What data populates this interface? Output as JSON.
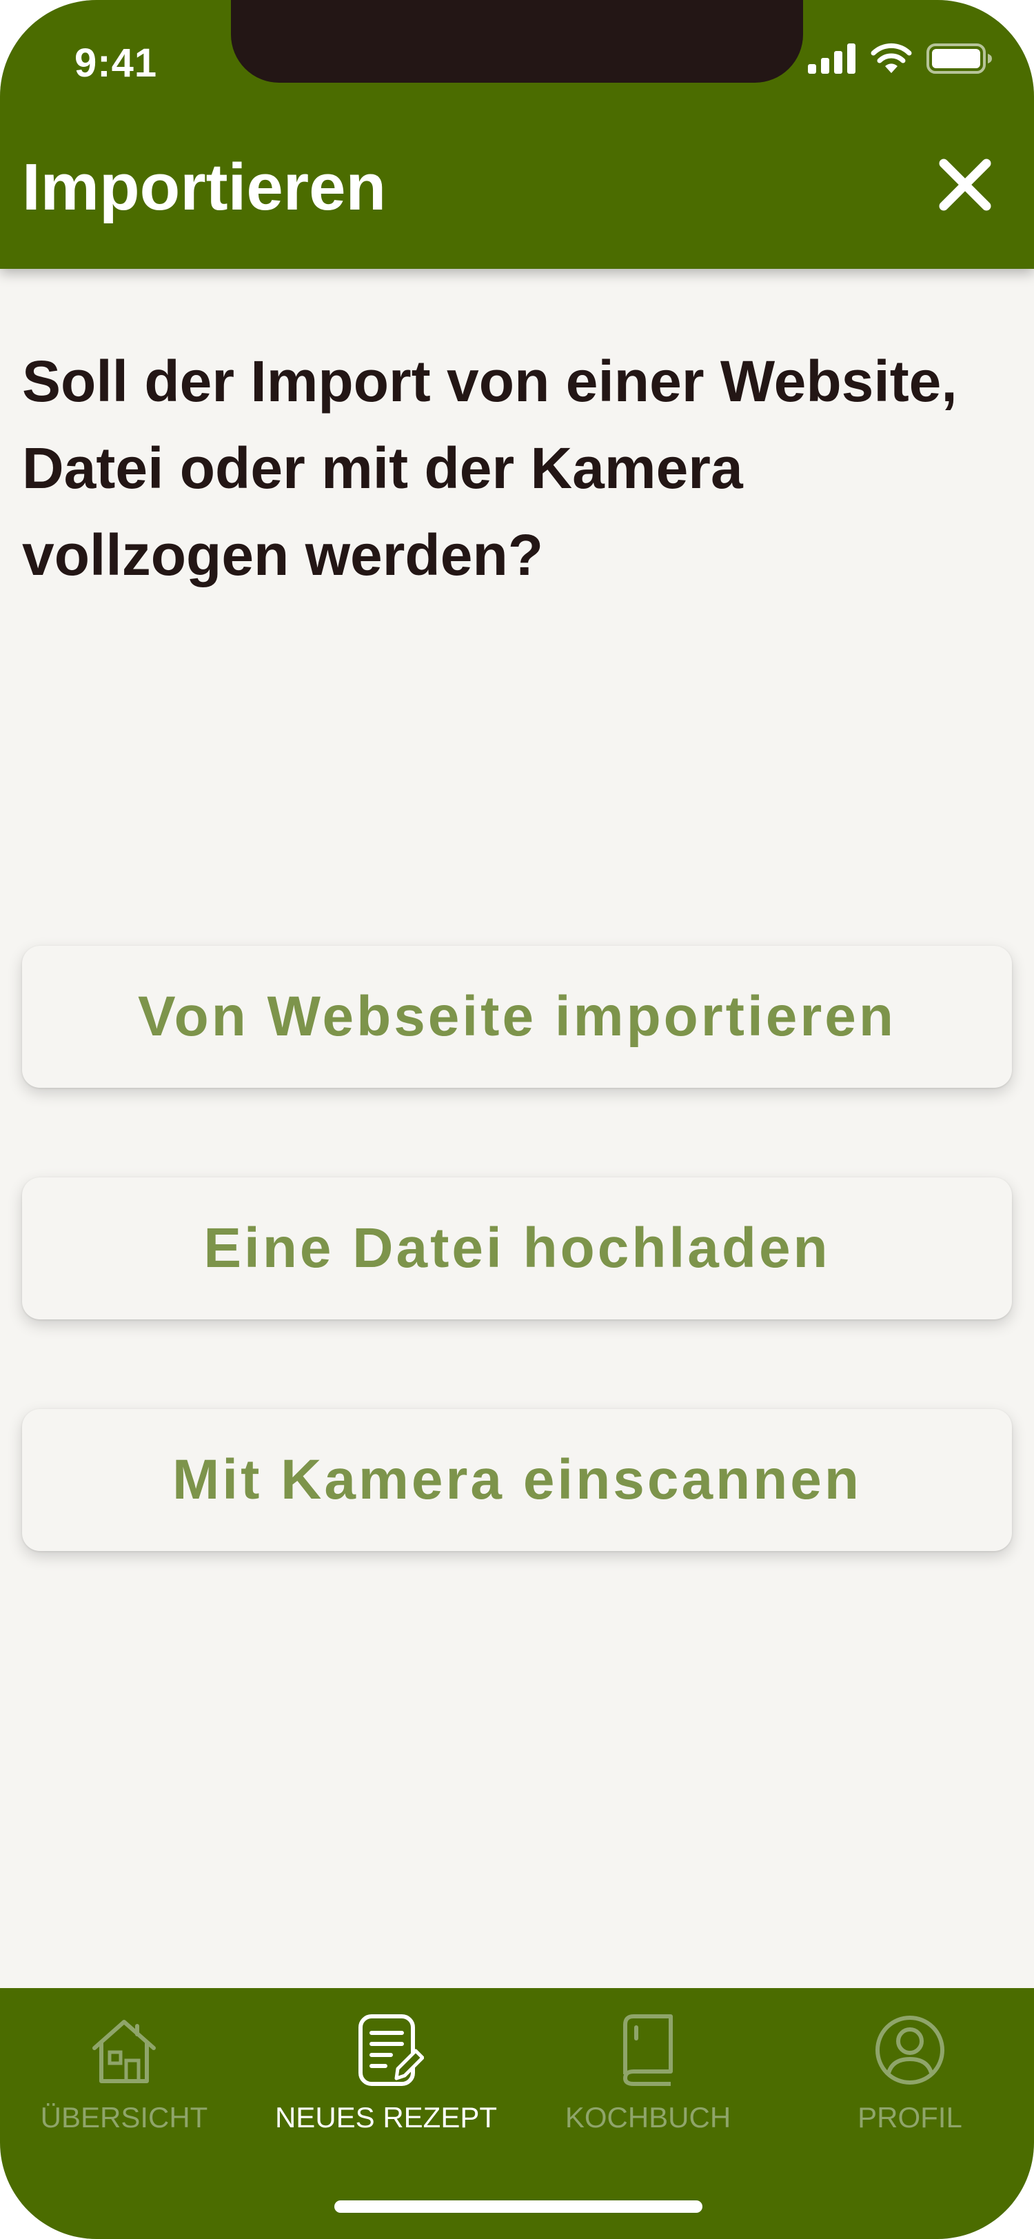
{
  "status_bar": {
    "time": "9:41",
    "icons": [
      "signal-icon",
      "wifi-icon",
      "battery-icon"
    ]
  },
  "app_bar": {
    "title": "Importieren",
    "close_icon": "close-icon"
  },
  "main": {
    "question": "Soll der Import von einer Website, Datei oder mit der Kamera vollzogen werden?",
    "options": [
      {
        "label": "Von Webseite importieren"
      },
      {
        "label": "Eine Datei hochladen"
      },
      {
        "label": "Mit Kamera einscannen"
      }
    ]
  },
  "tabbar": {
    "tabs": [
      {
        "label": "ÜBERSICHT",
        "icon": "house-icon",
        "active": false
      },
      {
        "label": "NEUES REZEPT",
        "icon": "note-edit-icon",
        "active": true
      },
      {
        "label": "KOCHBUCH",
        "icon": "book-icon",
        "active": false
      },
      {
        "label": "PROFIL",
        "icon": "user-circle-icon",
        "active": false
      }
    ]
  },
  "colors": {
    "primary": "#4b6c00",
    "background": "#f6f5f2",
    "accent_text": "#7d944b",
    "dark_text": "#231615",
    "inactive_tab": "#8fa56a"
  }
}
